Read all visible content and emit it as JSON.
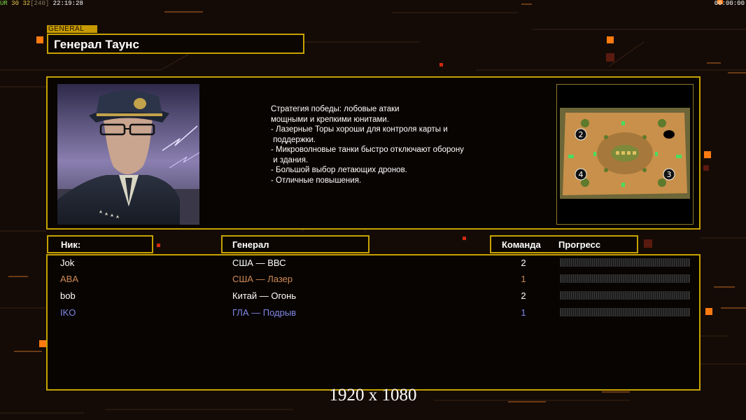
{
  "topbar": {
    "label": "UR",
    "fps_a": "30",
    "fps_b": "32",
    "bracket": "[240]",
    "clock": "22:19:28",
    "timer_right": "00:00:00"
  },
  "general_tag": "GENERAL",
  "general_name": "Генерал Таунс",
  "description": [
    "Стратегия победы: лобовые атаки",
    "мощными и крепкими юнитами.",
    "",
    "- Лазерные Торы хороши для контроля карты и",
    " поддержки.",
    "- Микроволновые танки быстро отключают оборону",
    " и здания.",
    "",
    "- Большой выбор летающих дронов.",
    "- Отличные повышения."
  ],
  "minimap": {
    "start_positions": [
      "2",
      "4",
      "3"
    ]
  },
  "columns": {
    "nick": "Ник:",
    "general": "Генерал",
    "team": "Команда",
    "progress": "Прогресс"
  },
  "players": [
    {
      "nick": "Jok",
      "general": "США — ВВС",
      "team": "2",
      "color": "#ffffff",
      "progress": 0
    },
    {
      "nick": "ABA",
      "general": "США — Лазер",
      "team": "1",
      "color": "#d08a55",
      "progress": 0
    },
    {
      "nick": "bob",
      "general": "Китай — Огонь",
      "team": "2",
      "color": "#ffffff",
      "progress": 0
    },
    {
      "nick": "IKO",
      "general": "ГЛА — Подрыв",
      "team": "1",
      "color": "#7f86e8",
      "progress": 0
    }
  ],
  "resolution_label": "1920 x 1080",
  "colors": {
    "accent": "#c6a100",
    "background": "#140b06",
    "highlight_orange": "#ff7a10"
  }
}
